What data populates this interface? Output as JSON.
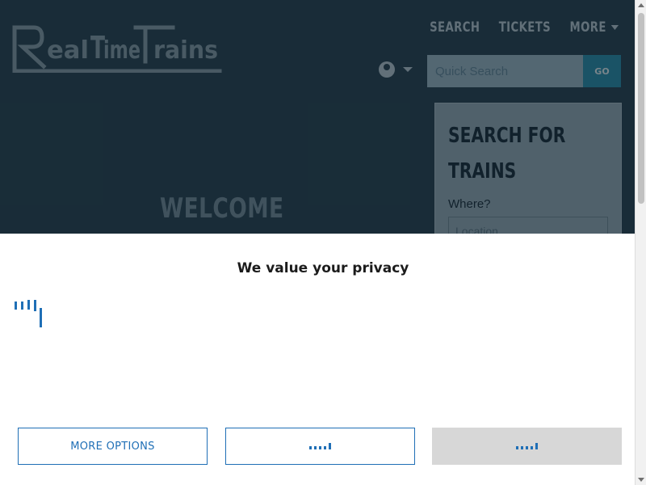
{
  "header": {
    "logo_text": "RealTimeTrains",
    "nav": [
      "SEARCH",
      "TICKETS",
      "MORE"
    ],
    "quick_search_placeholder": "Quick Search",
    "go_label": "GO"
  },
  "hero": {
    "welcome": "WELCOME"
  },
  "search_panel": {
    "title_line1": "SEARCH FOR",
    "title_line2": "TRAINS",
    "where_label": "Where?",
    "location_placeholder": "Location"
  },
  "consent": {
    "title": "We value your privacy",
    "more_options_label": "MORE OPTIONS"
  },
  "colors": {
    "page_bg": "#2b4d61",
    "accent_blue": "#1f6fb6",
    "go_button": "#2d8fb0"
  }
}
